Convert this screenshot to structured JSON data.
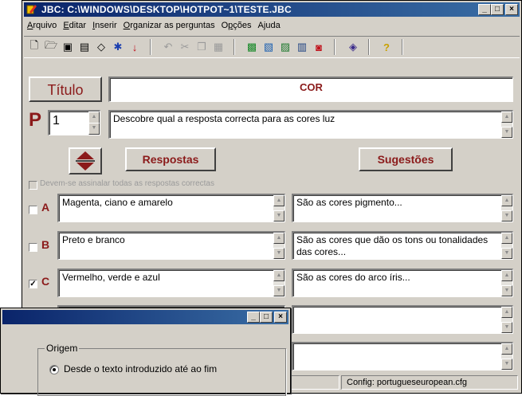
{
  "window": {
    "title": "JBC: C:\\WINDOWS\\DESKTOP\\HOTPOT~1\\TESTE.JBC",
    "controls": {
      "minimize": "_",
      "maximize": "□",
      "close": "×"
    }
  },
  "menu": [
    {
      "label": "Arquivo",
      "u": "A",
      "rest": "rquivo"
    },
    {
      "label": "Editar",
      "u": "E",
      "rest": "ditar"
    },
    {
      "label": "Inserir",
      "u": "I",
      "rest": "nserir"
    },
    {
      "label": "Organizar as perguntas",
      "u": "O",
      "rest": "rganizar as perguntas"
    },
    {
      "label": "Opções",
      "u": "p",
      "pre": "O",
      "rest": "ções"
    },
    {
      "label": "Ajuda",
      "u": "j",
      "pre": "A",
      "rest": "uda"
    }
  ],
  "toolbar": {
    "icons": [
      "new-icon",
      "open-icon",
      "save-icon",
      "save-as-icon",
      "clear-icon",
      "web-icon",
      "add-question-icon",
      "undo-icon",
      "cut-icon",
      "copy-icon",
      "paste-icon",
      "jmatch-icon",
      "jquiz-icon",
      "jmix-icon",
      "jcross-icon",
      "color-icon",
      "help-icon"
    ]
  },
  "title_label": "Título",
  "title_value": "COR",
  "question": {
    "label": "P",
    "number": "1",
    "text": "Descobre qual a resposta correcta para as cores luz"
  },
  "buttons": {
    "answers": "Respostas",
    "feedback": "Sugestões"
  },
  "all_correct_label": "Devem-se assinalar todas as respostas correctas",
  "answers": [
    {
      "letter": "A",
      "checked": "",
      "answer": "Magenta, ciano e amarelo",
      "feedback": "São as cores pigmento..."
    },
    {
      "letter": "B",
      "checked": "",
      "answer": "Preto e branco",
      "feedback": "São as cores que dão os tons ou tonalidades das cores..."
    },
    {
      "letter": "C",
      "checked": "✓",
      "answer": "Vermelho, verde e azul",
      "feedback": "São as cores do arco íris..."
    },
    {
      "letter": "",
      "checked": "",
      "answer": "",
      "feedback": ""
    },
    {
      "letter": "",
      "checked": "",
      "answer": "",
      "feedback": ""
    }
  ],
  "status": {
    "config": "Config: portugueseuropean.cfg"
  },
  "dialog": {
    "group_label": "Origem",
    "option_label": "Desde o texto introduzido até ao fim"
  }
}
